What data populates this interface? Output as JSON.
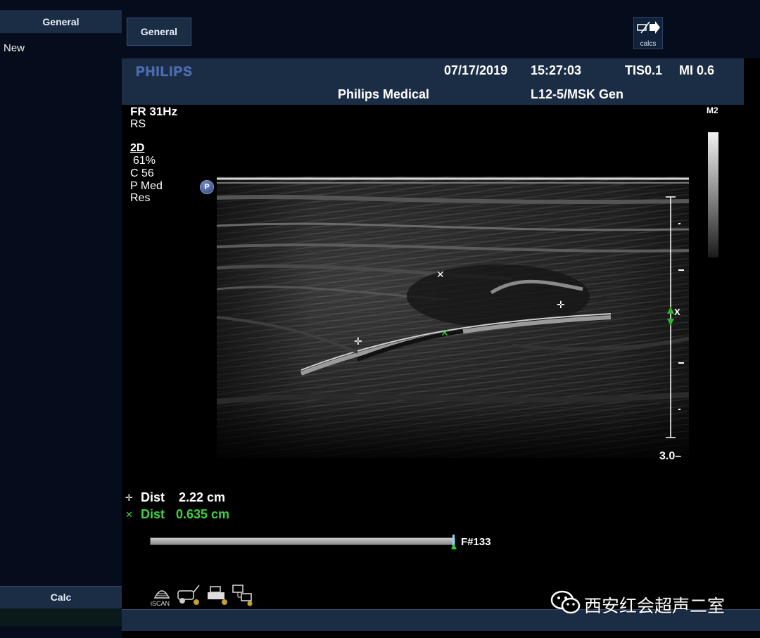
{
  "sidebar": {
    "tab_general": "General",
    "new_label": "New",
    "tab_calc": "Calc"
  },
  "toolbar": {
    "general_label": "General",
    "calcs_label": "calcs",
    "calcs_icon": "calcs-arrow-icon"
  },
  "header": {
    "logo": "PHILIPS",
    "date": "07/17/2019",
    "time": "15:27:03",
    "tis": "TIS0.1",
    "mi": "MI 0.6",
    "institution": "Philips Medical",
    "probe_preset": "L12-5/MSK Gen"
  },
  "imaging_params": {
    "frame_rate": "FR 31Hz",
    "rs": "RS",
    "mode": "2D",
    "gain": "61%",
    "compression": "C 56",
    "persistence": "P Med",
    "resolution": "Res",
    "badge": "P"
  },
  "grayscale": {
    "label": "M2"
  },
  "depth_scale": {
    "focus_label": "X",
    "max_depth_label": "3.0"
  },
  "measurements": [
    {
      "symbol": "+",
      "name": "Dist",
      "value": "2.22 cm",
      "color": "#ffffff"
    },
    {
      "symbol": "x",
      "name": "Dist",
      "value": "0.635 cm",
      "color": "#3fd13f"
    }
  ],
  "cine": {
    "frame_label": "F#133",
    "position_fraction": 1.0
  },
  "status_icons": [
    "iscan-probe-icon",
    "transducer-connector-icon",
    "printer-icon",
    "network-computer-icon"
  ],
  "status": {
    "iscan_label": "iSCAN"
  },
  "watermark": {
    "text": "西安红会超声二室",
    "icon": "wechat-icon"
  }
}
